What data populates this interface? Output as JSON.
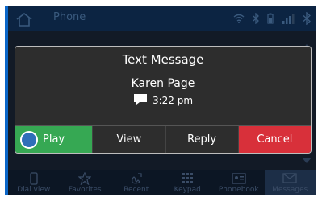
{
  "header": {
    "title": "Phone",
    "icons": [
      "home-icon",
      "wifi-icon",
      "bluetooth-icon",
      "battery-icon",
      "signal-icon",
      "bluetooth-outline-icon"
    ]
  },
  "dialog": {
    "title": "Text Message",
    "sender": "Karen Page",
    "time": "3:22 pm",
    "actions": {
      "play": "Play",
      "view": "View",
      "reply": "Reply",
      "cancel": "Cancel"
    }
  },
  "bottom_nav": {
    "items": [
      {
        "label": "Dial view",
        "icon": "phone-dialview-icon"
      },
      {
        "label": "Favorites",
        "icon": "star-icon"
      },
      {
        "label": "Recent",
        "icon": "recent-calls-icon"
      },
      {
        "label": "Keypad",
        "icon": "keypad-icon"
      },
      {
        "label": "Phonebook",
        "icon": "contacts-icon"
      },
      {
        "label": "Messages",
        "icon": "messages-icon"
      }
    ]
  },
  "colors": {
    "play": "#36a853",
    "cancel": "#d8303a",
    "accent_edge": "#0a66c8",
    "dialog_bg": "#2d2d2d"
  }
}
